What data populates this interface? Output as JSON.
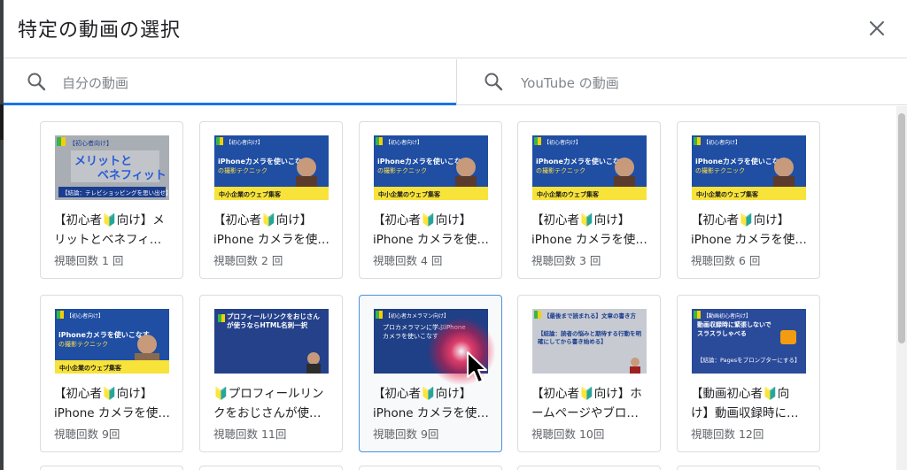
{
  "dialog": {
    "title": "特定の動画の選択"
  },
  "tabs": [
    {
      "placeholder": "自分の動画"
    },
    {
      "placeholder": "YouTube の動画"
    }
  ],
  "accent_color": "#1a73e8",
  "videos": [
    {
      "title_line1": "【初心者🔰向け】メ",
      "title_line2": "リットとベネフィ…",
      "views": "視聴回数 1 回",
      "thumb": {
        "style": "gray",
        "caption": "【初心者向け】",
        "headline": "メリットとベネフィットの違い",
        "sub": "【結論：テレビショッピングを思い出せ】"
      }
    },
    {
      "title_line1": "【初心者🔰向け】",
      "title_line2": "iPhone カメラを使…",
      "views": "視聴回数 2 回",
      "thumb": {
        "style": "blue",
        "caption": "【初心者向け】",
        "headline": "iPhoneカメラを使いこなす",
        "sub": "中小企業のウェブ集客"
      }
    },
    {
      "title_line1": "【初心者🔰向け】",
      "title_line2": "iPhone カメラを使…",
      "views": "視聴回数 4 回",
      "thumb": {
        "style": "blue",
        "caption": "【初心者向け】",
        "headline": "iPhoneカメラを使いこなす",
        "sub": "中小企業のウェブ集客"
      }
    },
    {
      "title_line1": "【初心者🔰向け】",
      "title_line2": "iPhone カメラを使…",
      "views": "視聴回数 3 回",
      "thumb": {
        "style": "blue",
        "caption": "【初心者向け】",
        "headline": "iPhoneカメラを使いこなす",
        "sub": "中小企業のウェブ集客"
      }
    },
    {
      "title_line1": "【初心者🔰向け】",
      "title_line2": "iPhone カメラを使…",
      "views": "視聴回数 6 回",
      "thumb": {
        "style": "blue",
        "caption": "【初心者向け】",
        "headline": "iPhoneカメラを使いこなす",
        "sub": "中小企業のウェブ集客"
      }
    },
    {
      "title_line1": "【初心者🔰向け】",
      "title_line2": "iPhone カメラを使…",
      "views": "視聴回数 9回",
      "thumb": {
        "style": "blue",
        "caption": "【初心者向け】",
        "headline": "iPhoneカメラを使いこなす",
        "sub": "中小企業のウェブ集客"
      }
    },
    {
      "title_line1": "🔰プロフィールリン",
      "title_line2": "クをおじさんが使…",
      "views": "視聴回数 11回",
      "thumb": {
        "style": "navy",
        "caption": "",
        "headline": "プロフィールリンクをおじさんが使うならHTML名刺一択",
        "sub": ""
      }
    },
    {
      "title_line1": "【初心者🔰向け】",
      "title_line2": "iPhone カメラを使…",
      "views": "視聴回数 9回",
      "thumb": {
        "style": "navy",
        "caption": "【初心者カメラマン向け】",
        "headline": "プロカメラマンに学ぶiPhoneカメラを使いこなす",
        "sub": ""
      }
    },
    {
      "title_line1": "【初心者🔰向け】ホ",
      "title_line2": "ームページやブロ…",
      "views": "視聴回数 10回",
      "thumb": {
        "style": "gray2",
        "caption": "【最後まで読まれる】文章の書き方",
        "headline": "【結論：読者の悩みと期待する行動を明確にしてから書き始める】",
        "sub": ""
      }
    },
    {
      "title_line1": "【動画初心者🔰向",
      "title_line2": "け】動画収録時に…",
      "views": "視聴回数 12回",
      "thumb": {
        "style": "navy",
        "caption": "【動画初心者向け】",
        "headline": "動画収録時に緊張しないでスラスラしゃべる",
        "sub": "【結論：Pagesをプロンプターにする】"
      }
    }
  ]
}
